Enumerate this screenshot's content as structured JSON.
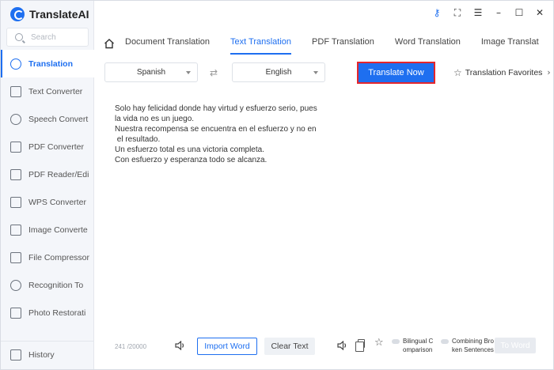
{
  "app": {
    "title": "TranslateAI"
  },
  "search": {
    "placeholder": "Search"
  },
  "sidebar": {
    "items": [
      {
        "label": "Translation",
        "icon": "translate-icon"
      },
      {
        "label": "Text Converter",
        "icon": "text-convert-icon"
      },
      {
        "label": "Speech Convert",
        "icon": "speech-icon"
      },
      {
        "label": "PDF Converter",
        "icon": "pdf-convert-icon"
      },
      {
        "label": "PDF Reader/Edi",
        "icon": "pdf-reader-icon"
      },
      {
        "label": "WPS Converter",
        "icon": "wps-icon"
      },
      {
        "label": "Image Converte",
        "icon": "image-icon"
      },
      {
        "label": "File Compressor",
        "icon": "compress-icon"
      },
      {
        "label": "Recognition To",
        "icon": "recognition-icon"
      },
      {
        "label": "Photo Restorati",
        "icon": "photo-restore-icon"
      }
    ],
    "history": "History"
  },
  "tabs": [
    {
      "label": "Document Translation"
    },
    {
      "label": "Text Translation"
    },
    {
      "label": "PDF Translation"
    },
    {
      "label": "Word Translation"
    },
    {
      "label": "Image Translat"
    }
  ],
  "toolbar": {
    "source_lang": "Spanish",
    "target_lang": "English",
    "translate_label": "Translate Now",
    "favorites_label": "Translation Favorites"
  },
  "editor": {
    "text": "Solo hay felicidad donde hay virtud y esfuerzo serio, pues\nla vida no es un juego.\nNuestra recompensa se encuentra en el esfuerzo y no en\n el resultado.\nUn esfuerzo total es una victoria completa.\nCon esfuerzo y esperanza todo se alcanza.",
    "count": "241 /20000"
  },
  "bottom": {
    "import_label": "Import Word",
    "clear_label": "Clear Text",
    "bilingual_label": "Bilingual C omparison",
    "bilingual_line1": "Bilingual C",
    "bilingual_line2": "omparison",
    "combining_line1": "Combining Bro",
    "combining_line2": "ken Sentences",
    "to_word_label": "To Word"
  },
  "colors": {
    "accent": "#1e6ff0",
    "highlight_border": "#e5262c"
  }
}
